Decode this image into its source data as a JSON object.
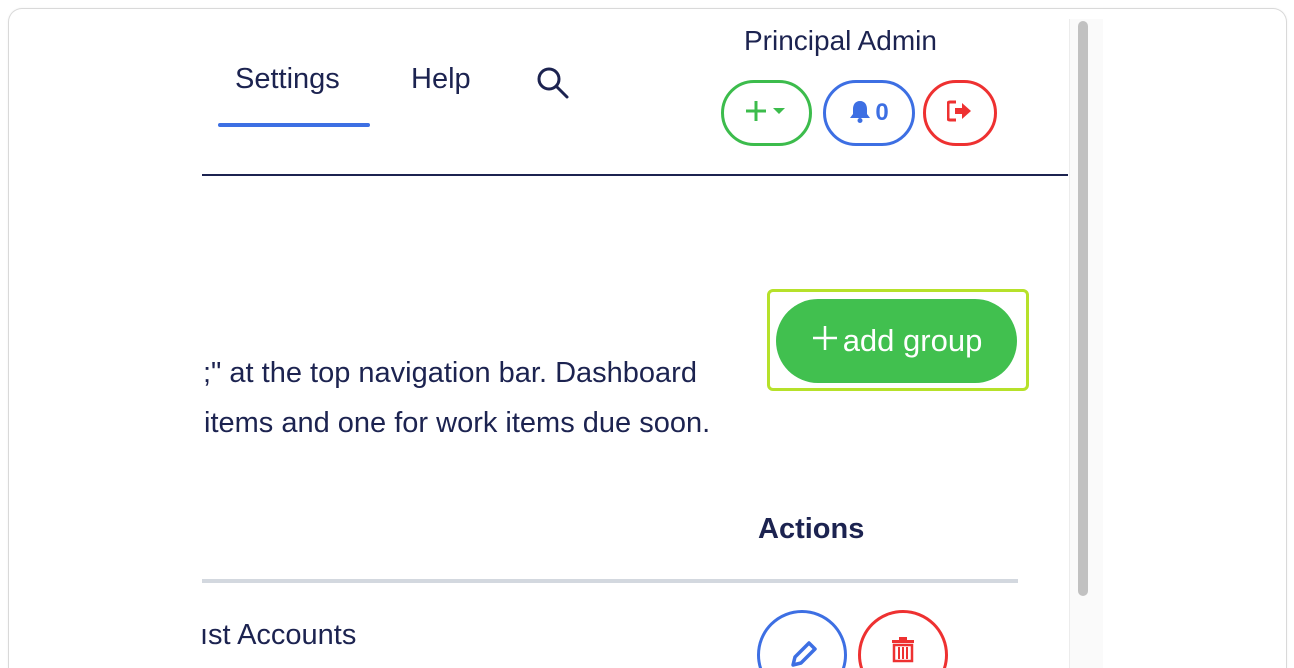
{
  "header": {
    "user_name": "Principal Admin",
    "nav": {
      "settings_label": "Settings",
      "help_label": "Help",
      "search_icon": "search-icon"
    },
    "quick_actions": {
      "add_icon": "plus-dropdown-icon",
      "notifications_icon": "bell-icon",
      "notifications_count": "0",
      "logout_icon": "logout-icon"
    }
  },
  "main": {
    "add_group_label": "add group",
    "add_group_icon": "plus-icon",
    "description_line_1": ";\" at the top navigation bar. Dashboard",
    "description_line_2": "items and one for work items due soon.",
    "table": {
      "actions_header": "Actions",
      "rows": [
        {
          "name": "ıst Accounts",
          "edit_icon": "pencil-icon",
          "delete_icon": "trash-icon"
        }
      ]
    }
  },
  "colors": {
    "navy_text": "#1c2350",
    "accent_blue": "#3d6fe3",
    "success_green": "#41c04f",
    "danger_red": "#ee3131",
    "highlight_lime": "#b6e12a"
  }
}
